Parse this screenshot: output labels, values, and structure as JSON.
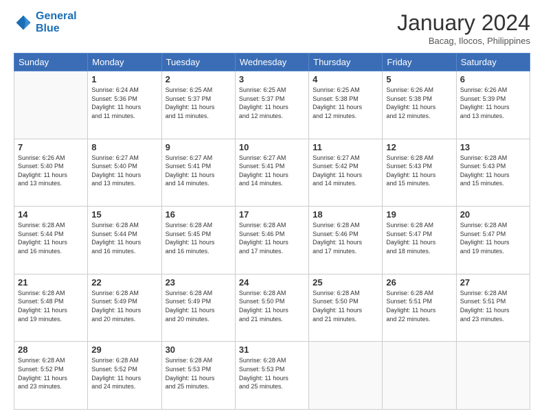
{
  "header": {
    "logo_line1": "General",
    "logo_line2": "Blue",
    "title": "January 2024",
    "location": "Bacag, Ilocos, Philippines"
  },
  "calendar": {
    "days": [
      "Sunday",
      "Monday",
      "Tuesday",
      "Wednesday",
      "Thursday",
      "Friday",
      "Saturday"
    ],
    "weeks": [
      [
        {
          "day": "",
          "content": ""
        },
        {
          "day": "1",
          "content": "Sunrise: 6:24 AM\nSunset: 5:36 PM\nDaylight: 11 hours\nand 11 minutes."
        },
        {
          "day": "2",
          "content": "Sunrise: 6:25 AM\nSunset: 5:37 PM\nDaylight: 11 hours\nand 11 minutes."
        },
        {
          "day": "3",
          "content": "Sunrise: 6:25 AM\nSunset: 5:37 PM\nDaylight: 11 hours\nand 12 minutes."
        },
        {
          "day": "4",
          "content": "Sunrise: 6:25 AM\nSunset: 5:38 PM\nDaylight: 11 hours\nand 12 minutes."
        },
        {
          "day": "5",
          "content": "Sunrise: 6:26 AM\nSunset: 5:38 PM\nDaylight: 11 hours\nand 12 minutes."
        },
        {
          "day": "6",
          "content": "Sunrise: 6:26 AM\nSunset: 5:39 PM\nDaylight: 11 hours\nand 13 minutes."
        }
      ],
      [
        {
          "day": "7",
          "content": "Sunrise: 6:26 AM\nSunset: 5:40 PM\nDaylight: 11 hours\nand 13 minutes."
        },
        {
          "day": "8",
          "content": "Sunrise: 6:27 AM\nSunset: 5:40 PM\nDaylight: 11 hours\nand 13 minutes."
        },
        {
          "day": "9",
          "content": "Sunrise: 6:27 AM\nSunset: 5:41 PM\nDaylight: 11 hours\nand 14 minutes."
        },
        {
          "day": "10",
          "content": "Sunrise: 6:27 AM\nSunset: 5:41 PM\nDaylight: 11 hours\nand 14 minutes."
        },
        {
          "day": "11",
          "content": "Sunrise: 6:27 AM\nSunset: 5:42 PM\nDaylight: 11 hours\nand 14 minutes."
        },
        {
          "day": "12",
          "content": "Sunrise: 6:28 AM\nSunset: 5:43 PM\nDaylight: 11 hours\nand 15 minutes."
        },
        {
          "day": "13",
          "content": "Sunrise: 6:28 AM\nSunset: 5:43 PM\nDaylight: 11 hours\nand 15 minutes."
        }
      ],
      [
        {
          "day": "14",
          "content": "Sunrise: 6:28 AM\nSunset: 5:44 PM\nDaylight: 11 hours\nand 16 minutes."
        },
        {
          "day": "15",
          "content": "Sunrise: 6:28 AM\nSunset: 5:44 PM\nDaylight: 11 hours\nand 16 minutes."
        },
        {
          "day": "16",
          "content": "Sunrise: 6:28 AM\nSunset: 5:45 PM\nDaylight: 11 hours\nand 16 minutes."
        },
        {
          "day": "17",
          "content": "Sunrise: 6:28 AM\nSunset: 5:46 PM\nDaylight: 11 hours\nand 17 minutes."
        },
        {
          "day": "18",
          "content": "Sunrise: 6:28 AM\nSunset: 5:46 PM\nDaylight: 11 hours\nand 17 minutes."
        },
        {
          "day": "19",
          "content": "Sunrise: 6:28 AM\nSunset: 5:47 PM\nDaylight: 11 hours\nand 18 minutes."
        },
        {
          "day": "20",
          "content": "Sunrise: 6:28 AM\nSunset: 5:47 PM\nDaylight: 11 hours\nand 19 minutes."
        }
      ],
      [
        {
          "day": "21",
          "content": "Sunrise: 6:28 AM\nSunset: 5:48 PM\nDaylight: 11 hours\nand 19 minutes."
        },
        {
          "day": "22",
          "content": "Sunrise: 6:28 AM\nSunset: 5:49 PM\nDaylight: 11 hours\nand 20 minutes."
        },
        {
          "day": "23",
          "content": "Sunrise: 6:28 AM\nSunset: 5:49 PM\nDaylight: 11 hours\nand 20 minutes."
        },
        {
          "day": "24",
          "content": "Sunrise: 6:28 AM\nSunset: 5:50 PM\nDaylight: 11 hours\nand 21 minutes."
        },
        {
          "day": "25",
          "content": "Sunrise: 6:28 AM\nSunset: 5:50 PM\nDaylight: 11 hours\nand 21 minutes."
        },
        {
          "day": "26",
          "content": "Sunrise: 6:28 AM\nSunset: 5:51 PM\nDaylight: 11 hours\nand 22 minutes."
        },
        {
          "day": "27",
          "content": "Sunrise: 6:28 AM\nSunset: 5:51 PM\nDaylight: 11 hours\nand 23 minutes."
        }
      ],
      [
        {
          "day": "28",
          "content": "Sunrise: 6:28 AM\nSunset: 5:52 PM\nDaylight: 11 hours\nand 23 minutes."
        },
        {
          "day": "29",
          "content": "Sunrise: 6:28 AM\nSunset: 5:52 PM\nDaylight: 11 hours\nand 24 minutes."
        },
        {
          "day": "30",
          "content": "Sunrise: 6:28 AM\nSunset: 5:53 PM\nDaylight: 11 hours\nand 25 minutes."
        },
        {
          "day": "31",
          "content": "Sunrise: 6:28 AM\nSunset: 5:53 PM\nDaylight: 11 hours\nand 25 minutes."
        },
        {
          "day": "",
          "content": ""
        },
        {
          "day": "",
          "content": ""
        },
        {
          "day": "",
          "content": ""
        }
      ]
    ]
  }
}
